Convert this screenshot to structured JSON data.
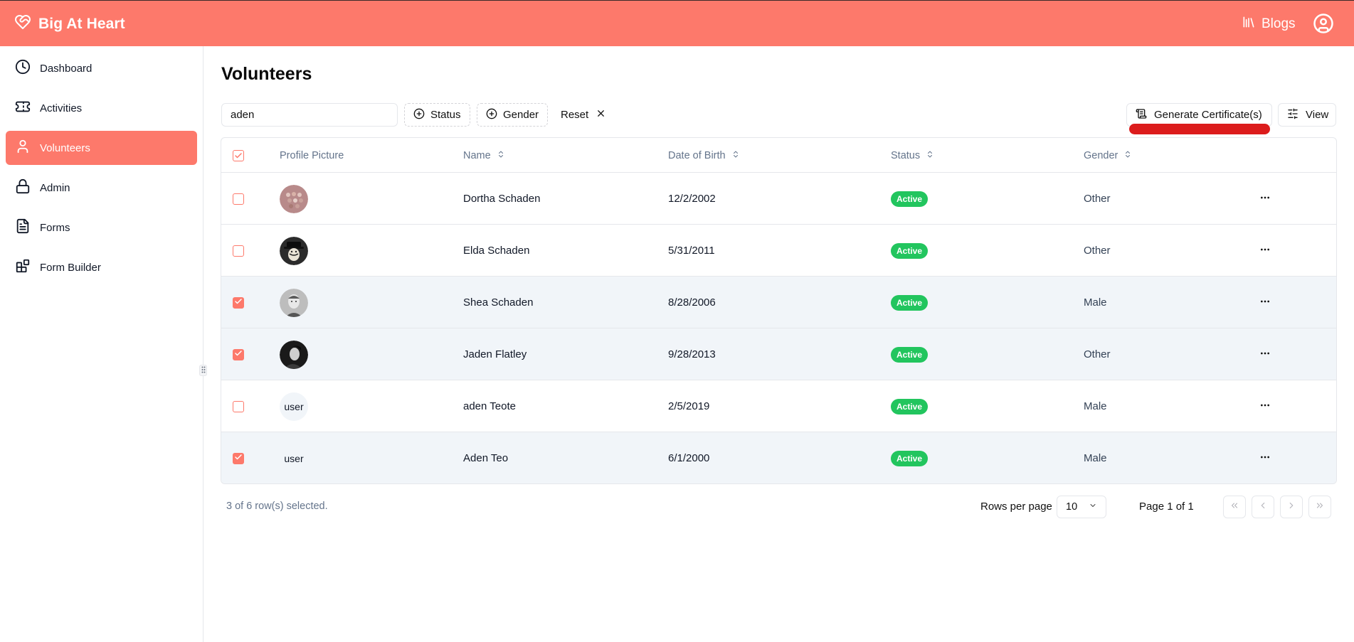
{
  "header": {
    "brand": "Big At Heart",
    "blogs_label": "Blogs",
    "bg_color": "#fd796b"
  },
  "sidebar": {
    "items": [
      {
        "label": "Dashboard",
        "icon": "clock-icon"
      },
      {
        "label": "Activities",
        "icon": "ticket-icon"
      },
      {
        "label": "Volunteers",
        "icon": "user-icon",
        "active": true
      },
      {
        "label": "Admin",
        "icon": "lock-icon"
      },
      {
        "label": "Forms",
        "icon": "document-icon"
      },
      {
        "label": "Form Builder",
        "icon": "blocks-icon"
      }
    ]
  },
  "main": {
    "title": "Volunteers",
    "search_value": "aden",
    "filters": {
      "status_label": "Status",
      "gender_label": "Gender",
      "reset_label": "Reset"
    },
    "generate_label": "Generate Certificate(s)",
    "view_label": "View"
  },
  "table": {
    "columns": [
      "Profile Picture",
      "Name",
      "Date of Birth",
      "Status",
      "Gender"
    ],
    "rows": [
      {
        "name": "Dortha Schaden",
        "dob": "12/2/2002",
        "status": "Active",
        "gender": "Other",
        "selected": false,
        "avatar": "photo"
      },
      {
        "name": "Elda Schaden",
        "dob": "5/31/2011",
        "status": "Active",
        "gender": "Other",
        "selected": false,
        "avatar": "photo"
      },
      {
        "name": "Shea Schaden",
        "dob": "8/28/2006",
        "status": "Active",
        "gender": "Male",
        "selected": true,
        "avatar": "photo"
      },
      {
        "name": "Jaden Flatley",
        "dob": "9/28/2013",
        "status": "Active",
        "gender": "Other",
        "selected": true,
        "avatar": "photo"
      },
      {
        "name": "aden Teote",
        "dob": "2/5/2019",
        "status": "Active",
        "gender": "Male",
        "selected": false,
        "avatar_text": "user"
      },
      {
        "name": "Aden Teo",
        "dob": "6/1/2000",
        "status": "Active",
        "gender": "Male",
        "selected": true,
        "avatar_text": "user"
      }
    ],
    "status_color": "#22c55e",
    "accent_color": "#fd796b"
  },
  "footer": {
    "selection_text": "3 of 6 row(s) selected.",
    "rows_per_page_label": "Rows per page",
    "rows_per_page_value": "10",
    "page_info": "Page 1 of 1"
  }
}
